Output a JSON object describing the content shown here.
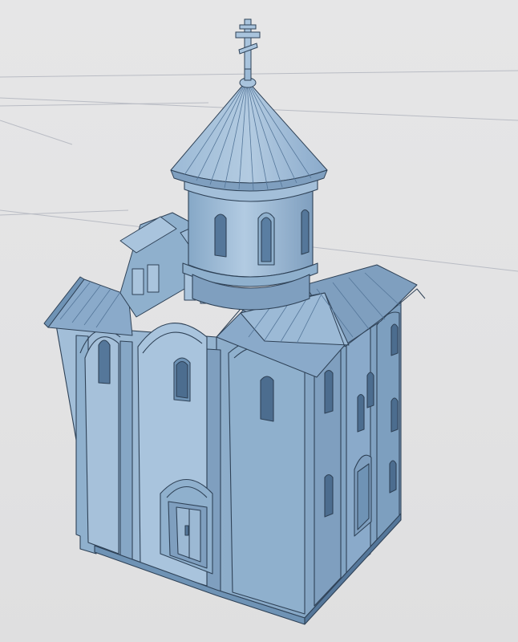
{
  "viewport": {
    "background": "#e3e3e4",
    "grid_line_color": "#b9bcc4"
  },
  "model": {
    "subject": "church-with-cross-and-dome",
    "colors": {
      "light": "#a9c4dd",
      "mid": "#8fb0cd",
      "dark": "#6f93b5",
      "shadow": "#55779a",
      "outline": "#2f4257"
    },
    "icons": [
      "orthodox-cross-icon"
    ]
  }
}
